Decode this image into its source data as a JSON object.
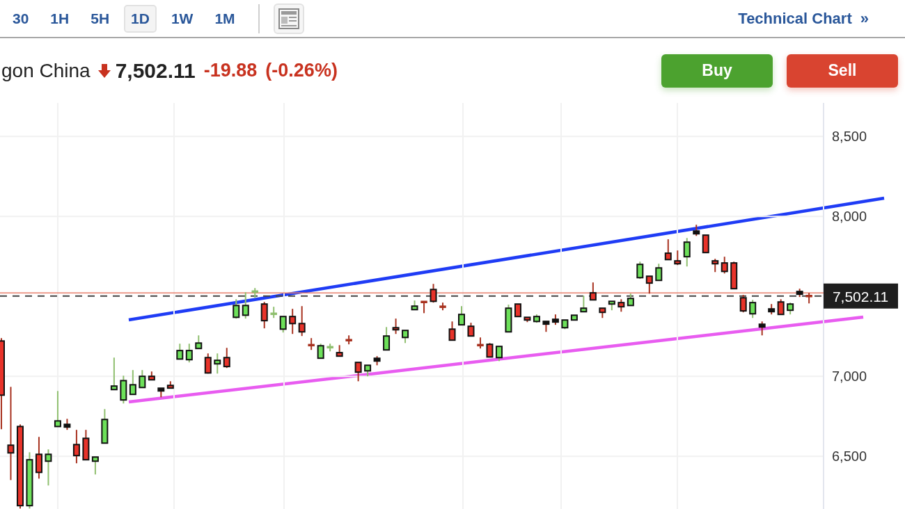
{
  "toolbar": {
    "timeframes": [
      {
        "label": "30",
        "selected": false
      },
      {
        "label": "1H",
        "selected": false
      },
      {
        "label": "5H",
        "selected": false
      },
      {
        "label": "1D",
        "selected": true
      },
      {
        "label": "1W",
        "selected": false
      },
      {
        "label": "1M",
        "selected": false
      }
    ],
    "technical_chart_link": "Technical Chart",
    "link_arrow": "»"
  },
  "quote": {
    "name": "gon China",
    "price": "7,502.11",
    "change": "-19.88",
    "change_percent": "(-0.26%)"
  },
  "actions": [
    {
      "label": "Buy",
      "kind": "buy"
    },
    {
      "label": "Sell",
      "kind": "sell"
    }
  ],
  "chart": {
    "chart_data": {
      "type": "candlestick",
      "grid": true,
      "ylim": [
        6170,
        8710
      ],
      "yticks": [
        {
          "value": 6500,
          "label": "6,500"
        },
        {
          "value": 7000,
          "label": "7,000"
        },
        {
          "value": 8000,
          "label": "8,000"
        },
        {
          "value": 8500,
          "label": "8,500"
        }
      ],
      "categories": [
        null,
        null,
        null,
        null,
        null,
        null,
        null,
        null,
        null,
        null,
        null,
        null,
        null,
        null,
        null,
        null,
        null,
        null,
        null,
        null,
        null,
        null,
        null,
        null,
        null,
        null,
        null,
        null,
        null,
        null,
        null,
        null,
        null,
        null,
        null,
        null,
        null,
        null,
        null,
        null,
        null,
        null,
        null,
        null,
        null,
        null,
        null,
        null,
        null,
        null,
        null,
        null,
        null,
        null,
        null,
        null,
        null,
        null,
        null,
        null,
        null,
        null,
        null,
        null,
        null,
        null,
        null,
        null,
        null,
        null,
        null,
        null,
        null,
        null,
        null,
        null,
        null,
        null,
        null,
        null,
        null,
        null,
        null,
        null,
        null,
        null,
        null
      ],
      "ohlc": [
        [
          7221,
          7239,
          6669,
          6882
        ],
        [
          6569,
          6934,
          6351,
          6521
        ],
        [
          6686,
          6699,
          6173,
          6191
        ],
        [
          6191,
          6525,
          6173,
          6478
        ],
        [
          6512,
          6621,
          6360,
          6399
        ],
        [
          6469,
          6543,
          6317,
          6512
        ],
        [
          6686,
          6908,
          6686,
          6721
        ],
        [
          6691,
          6734,
          6665,
          6691
        ],
        [
          6573,
          6665,
          6456,
          6504
        ],
        [
          6612,
          6665,
          6478,
          6478
        ],
        [
          6469,
          6495,
          6386,
          6495
        ],
        [
          6582,
          6795,
          6582,
          6730
        ],
        [
          6917,
          7117,
          6917,
          6939
        ],
        [
          6852,
          7004,
          6830,
          6973
        ],
        [
          6887,
          7039,
          6887,
          6947
        ],
        [
          6930,
          7039,
          6930,
          7000
        ],
        [
          7000,
          7030,
          6978,
          6978
        ],
        [
          6917,
          6917,
          6869,
          6917
        ],
        [
          6943,
          6969,
          6926,
          6926
        ],
        [
          7108,
          7204,
          7108,
          7161
        ],
        [
          7104,
          7204,
          7087,
          7161
        ],
        [
          7174,
          7256,
          7174,
          7208
        ],
        [
          7117,
          7143,
          7017,
          7021
        ],
        [
          7078,
          7143,
          7017,
          7100
        ],
        [
          7117,
          7178,
          7052,
          7061
        ],
        [
          7369,
          7482,
          7361,
          7443
        ],
        [
          7382,
          7526,
          7361,
          7443
        ],
        [
          7528,
          7552,
          7491,
          7530
        ],
        [
          7452,
          7465,
          7300,
          7348
        ],
        [
          7389,
          7435,
          7365,
          7391
        ],
        [
          7295,
          7374,
          7274,
          7374
        ],
        [
          7374,
          7422,
          7265,
          7330
        ],
        [
          7330,
          7439,
          7252,
          7278
        ],
        [
          7197,
          7239,
          7165,
          7195
        ],
        [
          7113,
          7204,
          7113,
          7191
        ],
        [
          7180,
          7204,
          7156,
          7182
        ],
        [
          7148,
          7195,
          7126,
          7126
        ],
        [
          7228,
          7256,
          7200,
          7226
        ],
        [
          7087,
          7087,
          6969,
          7026
        ],
        [
          7034,
          7069,
          7000,
          7069
        ],
        [
          7104,
          7126,
          7069,
          7104
        ],
        [
          7165,
          7308,
          7165,
          7252
        ],
        [
          7304,
          7361,
          7265,
          7291
        ],
        [
          7243,
          7287,
          7208,
          7287
        ],
        [
          7417,
          7474,
          7417,
          7439
        ],
        [
          7467,
          7467,
          7395,
          7465
        ],
        [
          7543,
          7578,
          7461,
          7469
        ],
        [
          7437,
          7461,
          7413,
          7435
        ],
        [
          7295,
          7343,
          7226,
          7226
        ],
        [
          7322,
          7439,
          7322,
          7387
        ],
        [
          7313,
          7335,
          7252,
          7252
        ],
        [
          7197,
          7243,
          7174,
          7195
        ],
        [
          7200,
          7208,
          7121,
          7121
        ],
        [
          7117,
          7187,
          7095,
          7187
        ],
        [
          7278,
          7448,
          7278,
          7426
        ],
        [
          7452,
          7452,
          7374,
          7374
        ],
        [
          7369,
          7369,
          7339,
          7352
        ],
        [
          7343,
          7387,
          7335,
          7374
        ],
        [
          7335,
          7335,
          7278,
          7335
        ],
        [
          7348,
          7387,
          7322,
          7348
        ],
        [
          7304,
          7352,
          7295,
          7352
        ],
        [
          7352,
          7382,
          7352,
          7382
        ],
        [
          7404,
          7504,
          7404,
          7426
        ],
        [
          7522,
          7587,
          7478,
          7478
        ],
        [
          7426,
          7426,
          7365,
          7400
        ],
        [
          7452,
          7469,
          7413,
          7469
        ],
        [
          7461,
          7482,
          7404,
          7435
        ],
        [
          7443,
          7517,
          7443,
          7487
        ],
        [
          7617,
          7717,
          7609,
          7700
        ],
        [
          7626,
          7626,
          7517,
          7583
        ],
        [
          7600,
          7704,
          7600,
          7678
        ],
        [
          7770,
          7857,
          7730,
          7730
        ],
        [
          7722,
          7787,
          7696,
          7704
        ],
        [
          7748,
          7865,
          7687,
          7839
        ],
        [
          7900,
          7948,
          7878,
          7900
        ],
        [
          7883,
          7883,
          7774,
          7774
        ],
        [
          7722,
          7735,
          7652,
          7704
        ],
        [
          7709,
          7748,
          7643,
          7656
        ],
        [
          7709,
          7717,
          7548,
          7548
        ],
        [
          7491,
          7509,
          7400,
          7409
        ],
        [
          7391,
          7478,
          7365,
          7461
        ],
        [
          7317,
          7343,
          7256,
          7317
        ],
        [
          7413,
          7452,
          7387,
          7413
        ],
        [
          7465,
          7482,
          7387,
          7387
        ],
        [
          7413,
          7461,
          7387,
          7452
        ],
        [
          7522,
          7548,
          7496,
          7522
        ],
        [
          7505,
          7522,
          7456,
          7502
        ]
      ],
      "ref_lines": [
        {
          "axis": "y",
          "value": 7521.99,
          "color": "#e8806e"
        },
        {
          "axis": "y",
          "value": 7502.11,
          "color": "#444444",
          "label": "7,502.11"
        }
      ]
    }
  }
}
